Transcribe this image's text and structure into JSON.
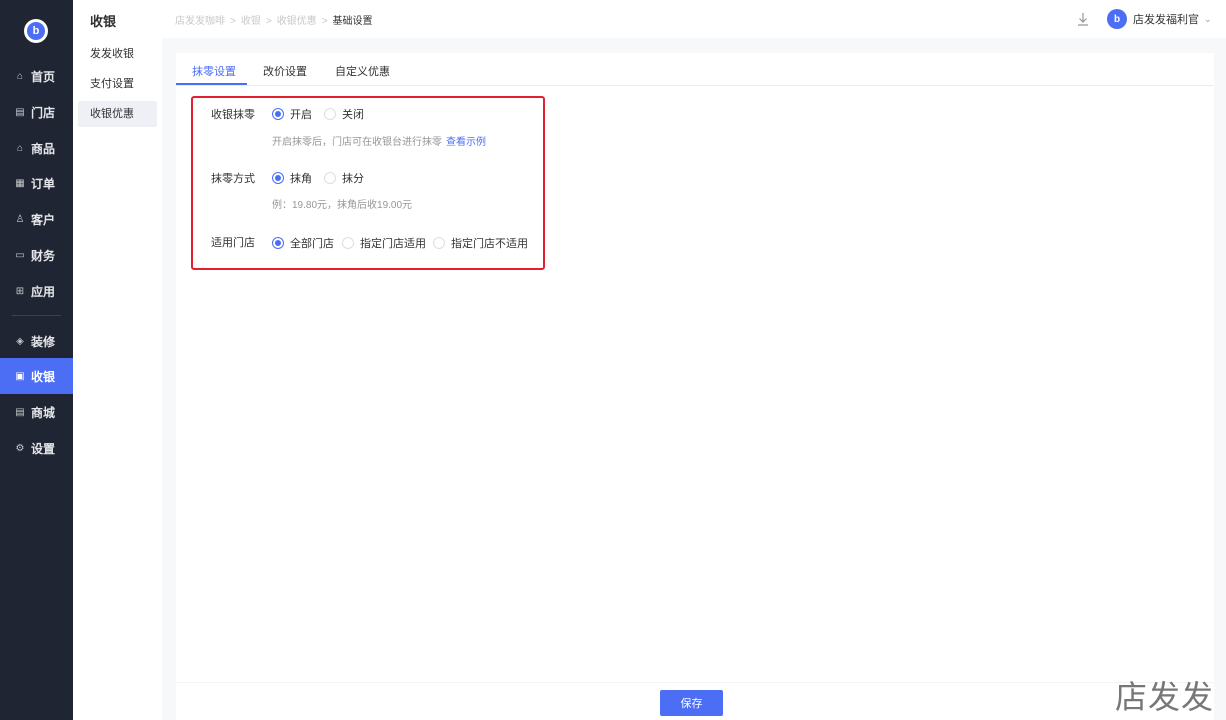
{
  "nav": {
    "logo_text": "b",
    "items": [
      {
        "label": "首页",
        "icon": "home-icon",
        "glyph": "⌂"
      },
      {
        "label": "门店",
        "icon": "store-icon",
        "glyph": "▤"
      },
      {
        "label": "商品",
        "icon": "bag-icon",
        "glyph": "⌂"
      },
      {
        "label": "订单",
        "icon": "order-icon",
        "glyph": "▦"
      },
      {
        "label": "客户",
        "icon": "user-icon",
        "glyph": "♙"
      },
      {
        "label": "财务",
        "icon": "wallet-icon",
        "glyph": "▭"
      },
      {
        "label": "应用",
        "icon": "apps-icon",
        "glyph": "⊞"
      },
      {
        "label": "装修",
        "icon": "layers-icon",
        "glyph": "◈"
      },
      {
        "label": "收银",
        "icon": "cashier-icon",
        "glyph": "▣",
        "active": true
      },
      {
        "label": "商城",
        "icon": "shop-icon",
        "glyph": "▤"
      },
      {
        "label": "设置",
        "icon": "gear-icon",
        "glyph": "⚙"
      }
    ]
  },
  "subnav": {
    "title": "收银",
    "items": [
      "发发收银",
      "支付设置",
      "收银优惠"
    ],
    "active_index": 2
  },
  "header": {
    "breadcrumb": [
      "店发发咖啡",
      "收银",
      "收银优惠",
      "基础设置"
    ],
    "separator": ">",
    "user_name": "店发发福利官",
    "avatar_text": "b"
  },
  "tabs": [
    "抹零设置",
    "改价设置",
    "自定义优惠"
  ],
  "form": {
    "rounding": {
      "label": "收银抹零",
      "options": [
        "开启",
        "关闭"
      ],
      "selected": "开启",
      "help": "开启抹零后，门店可在收银台进行抹零",
      "help_link": "查看示例"
    },
    "method": {
      "label": "抹零方式",
      "options": [
        "抹角",
        "抹分"
      ],
      "selected": "抹角",
      "help": "例：19.80元，抹角后收19.00元"
    },
    "stores": {
      "label": "适用门店",
      "options": [
        "全部门店",
        "指定门店适用",
        "指定门店不适用"
      ],
      "selected": "全部门店"
    }
  },
  "footer": {
    "save_label": "保存"
  },
  "watermark": "店发发",
  "colors": {
    "accent": "#4b6ef5",
    "nav_bg": "#1f2532",
    "highlight": "#e3212e"
  }
}
